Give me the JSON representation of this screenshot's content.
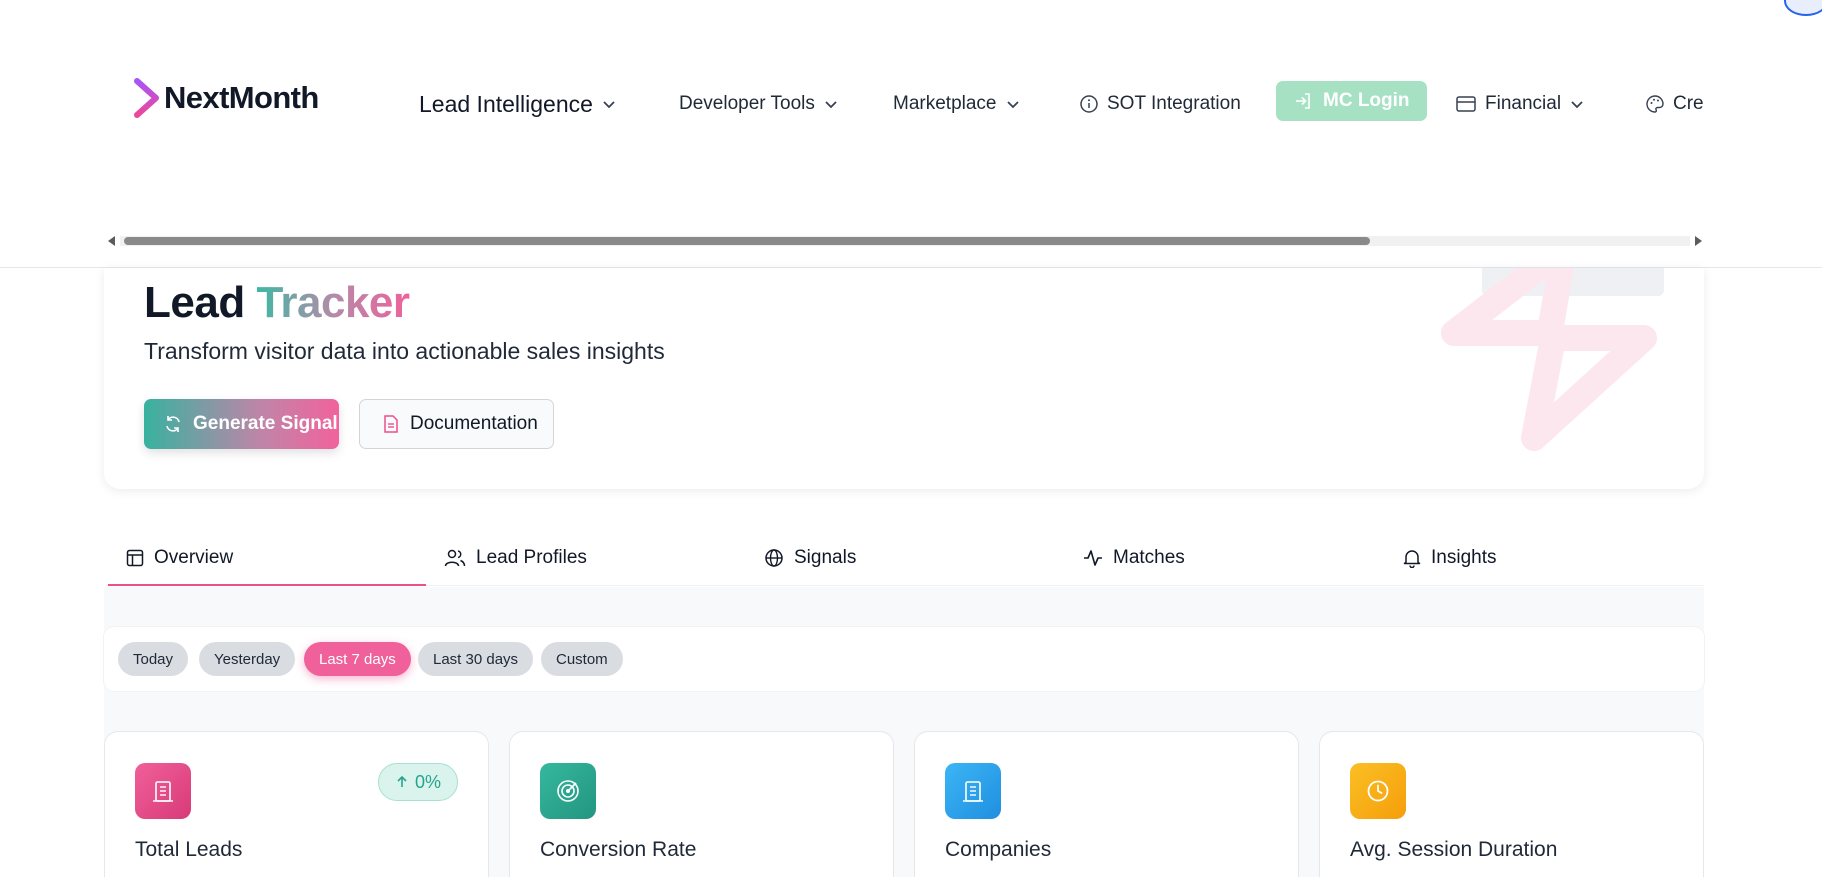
{
  "header": {
    "logo_text": "NextMonth",
    "nav": [
      {
        "label": "Lead Intelligence"
      },
      {
        "label": "Developer Tools"
      },
      {
        "label": "Marketplace"
      },
      {
        "label": "SOT Integration"
      },
      {
        "label": "MC Login"
      },
      {
        "label": "Financial"
      },
      {
        "label": "Cre"
      }
    ]
  },
  "hero": {
    "title_part1": "Lead",
    "title_part2": "Tracker",
    "subtitle": "Transform visitor data into actionable sales insights",
    "primary_button": "Generate Signal",
    "secondary_button": "Documentation"
  },
  "tabs": [
    {
      "label": "Overview",
      "icon": "layout-icon"
    },
    {
      "label": "Lead Profiles",
      "icon": "users-icon"
    },
    {
      "label": "Signals",
      "icon": "globe-icon"
    },
    {
      "label": "Matches",
      "icon": "activity-icon"
    },
    {
      "label": "Insights",
      "icon": "bell-icon"
    }
  ],
  "filters": {
    "options": [
      "Today",
      "Yesterday",
      "Last 7 days",
      "Last 30 days",
      "Custom"
    ],
    "selected": "Last 7 days"
  },
  "stats": [
    {
      "label": "Total Leads",
      "icon": "building-icon",
      "color": "#e84d8a",
      "change": "0%"
    },
    {
      "label": "Conversion Rate",
      "icon": "target-icon",
      "color": "#2fae95"
    },
    {
      "label": "Companies",
      "icon": "building-icon",
      "color": "#2aa3f0"
    },
    {
      "label": "Avg. Session Duration",
      "icon": "clock-icon",
      "color": "#f5b01d"
    }
  ],
  "colors": {
    "accent_pink": "#f0609a",
    "accent_teal": "#3db8a4",
    "mc_login_green": "#a7e1c4"
  }
}
